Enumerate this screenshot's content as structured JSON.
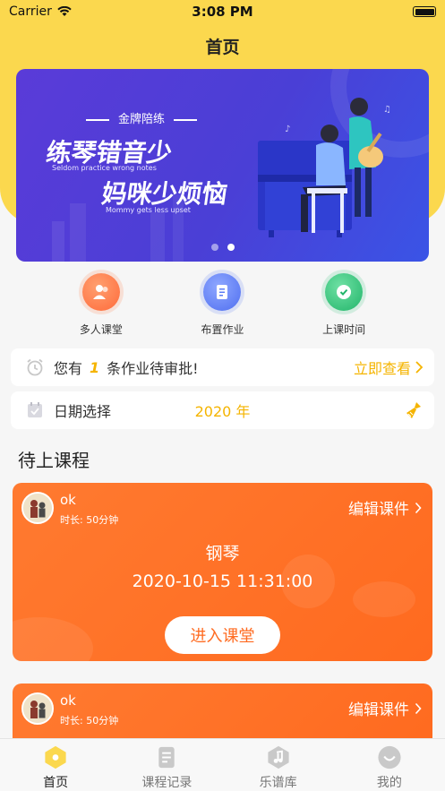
{
  "status_bar": {
    "carrier": "Carrier",
    "time": "3:08 PM"
  },
  "nav": {
    "title": "首页"
  },
  "banner": {
    "subtitle": "金牌陪练",
    "title_line1": "练琴错音少",
    "title_line1_en": "Seldom practice wrong notes",
    "title_line2": "妈咪少烦恼",
    "title_line2_en": "Mommy gets less upset",
    "page_count": 2,
    "active_page": 2
  },
  "quick_actions": [
    {
      "label": "多人课堂",
      "icon": "people-icon",
      "color": "#ff7a45"
    },
    {
      "label": "布置作业",
      "icon": "document-icon",
      "color": "#5b7cf5"
    },
    {
      "label": "上课时间",
      "icon": "clock-icon",
      "color": "#34c27a"
    }
  ],
  "notice": {
    "prefix": "您有",
    "count": "1",
    "suffix": "条作业待审批!",
    "action": "立即查看"
  },
  "date_picker": {
    "label": "日期选择",
    "year": "2020 年"
  },
  "section_title": "待上课程",
  "lessons": [
    {
      "teacher": "ok",
      "duration": "时长: 50分钟",
      "edit": "编辑课件",
      "course": "钢琴",
      "datetime": "2020-10-15 11:31:00",
      "enter": "进入课堂"
    },
    {
      "teacher": "ok",
      "duration": "时长: 50分钟",
      "edit": "编辑课件"
    }
  ],
  "tabbar": [
    {
      "label": "首页",
      "icon": "home-icon",
      "active": true
    },
    {
      "label": "课程记录",
      "icon": "record-icon",
      "active": false
    },
    {
      "label": "乐谱库",
      "icon": "music-library-icon",
      "active": false
    },
    {
      "label": "我的",
      "icon": "profile-icon",
      "active": false
    }
  ],
  "colors": {
    "brand_yellow": "#fbd84e",
    "accent_orange": "#ff6a1f",
    "highlight": "#f5b400"
  }
}
